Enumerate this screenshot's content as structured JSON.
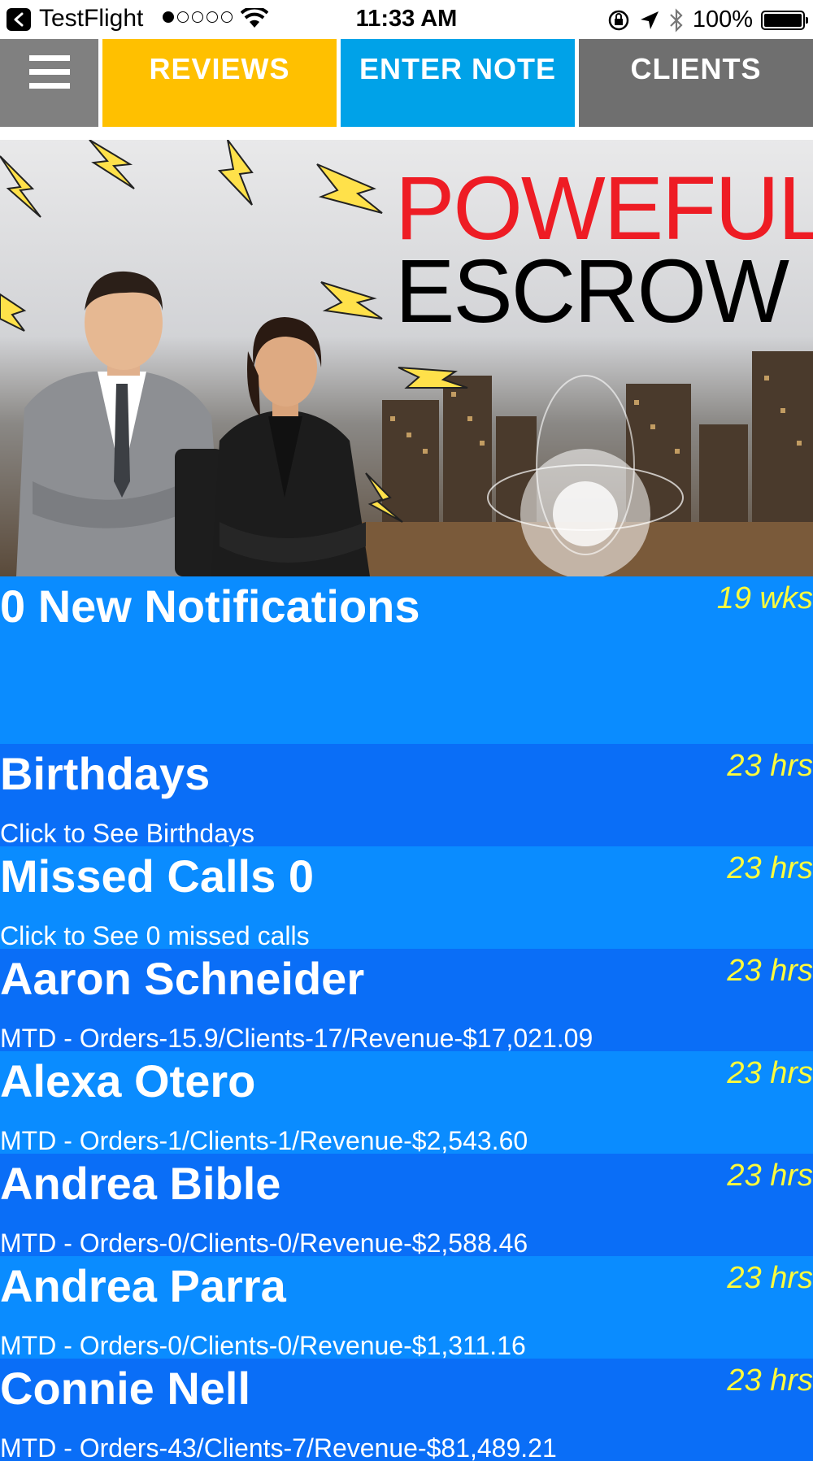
{
  "status_bar": {
    "app_name": "TestFlight",
    "time": "11:33 AM",
    "battery": "100%",
    "signal_bars": 1,
    "signal_total": 5
  },
  "nav": {
    "menu_icon": "hamburger-icon",
    "tabs": [
      {
        "label": "REVIEWS",
        "color": "#ffc000"
      },
      {
        "label": "ENTER NOTE",
        "color": "#00a2e8"
      },
      {
        "label": "CLIENTS",
        "color": "#6f6f6f"
      }
    ]
  },
  "banner": {
    "line1": "POWEFUL",
    "line2": "ESCROW"
  },
  "list": [
    {
      "title": "0 New Notifications",
      "subtitle": "",
      "time": "19 wks",
      "color": "#0a8cff"
    },
    {
      "title": "Birthdays",
      "subtitle": "Click to See Birthdays",
      "time": "23 hrs",
      "color": "#0a6ef7"
    },
    {
      "title": "Missed Calls 0",
      "subtitle": "Click to See 0 missed calls",
      "time": "23 hrs",
      "color": "#0a8cff"
    },
    {
      "title": "Aaron Schneider",
      "subtitle": "MTD - Orders-15.9/Clients-17/Revenue-$17,021.09",
      "time": "23 hrs",
      "color": "#0a6ef7"
    },
    {
      "title": "Alexa Otero",
      "subtitle": "MTD - Orders-1/Clients-1/Revenue-$2,543.60",
      "time": "23 hrs",
      "color": "#0a8cff"
    },
    {
      "title": "Andrea Bible",
      "subtitle": "MTD - Orders-0/Clients-0/Revenue-$2,588.46",
      "time": "23 hrs",
      "color": "#0a6ef7"
    },
    {
      "title": "Andrea Parra",
      "subtitle": "MTD - Orders-0/Clients-0/Revenue-$1,311.16",
      "time": "23 hrs",
      "color": "#0a8cff"
    },
    {
      "title": "Connie Nell",
      "subtitle": "MTD - Orders-43/Clients-7/Revenue-$81,489.21",
      "time": "23 hrs",
      "color": "#0a6ef7"
    }
  ]
}
